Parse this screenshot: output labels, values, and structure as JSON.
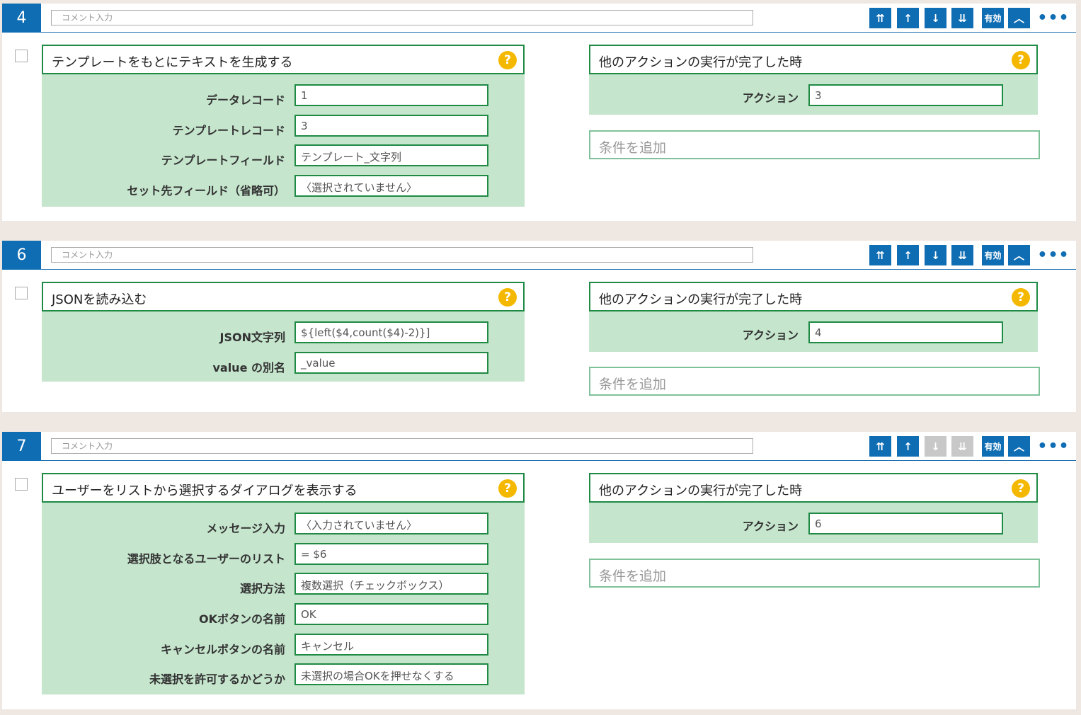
{
  "comment_placeholder": "コメント入力",
  "toolbar": {
    "top_icon": "⇈",
    "up_icon": "↑",
    "down_icon": "↓",
    "bottom_icon": "⇊",
    "enable_label": "有効",
    "collapse_icon": "︿",
    "more_icon": "•••"
  },
  "help_icon": "?",
  "condition": {
    "title": "他のアクションの実行が完了した時",
    "action_label": "アクション",
    "add_placeholder": "条件を追加"
  },
  "blocks": [
    {
      "number": "4",
      "title": "テンプレートをもとにテキストを生成する",
      "fields": [
        {
          "label": "データレコード",
          "value": "1"
        },
        {
          "label": "テンプレートレコード",
          "value": "3"
        },
        {
          "label": "テンプレートフィールド",
          "value": "テンプレート_文字列"
        },
        {
          "label": "セット先フィールド（省略可）",
          "value": "〈選択されていません〉"
        }
      ],
      "condition_action": "3"
    },
    {
      "number": "6",
      "title": "JSONを読み込む",
      "fields": [
        {
          "label": "JSON文字列",
          "value": "${left($4,count($4)-2)}]"
        },
        {
          "label": "value の別名",
          "value": "_value"
        }
      ],
      "condition_action": "4"
    },
    {
      "number": "7",
      "title": "ユーザーをリストから選択するダイアログを表示する",
      "fields": [
        {
          "label": "メッセージ入力",
          "value": "〈入力されていません〉"
        },
        {
          "label": "選択肢となるユーザーのリスト",
          "value": "= $6"
        },
        {
          "label": "選択方法",
          "value": "複数選択（チェックボックス）"
        },
        {
          "label": "OKボタンの名前",
          "value": "OK"
        },
        {
          "label": "キャンセルボタンの名前",
          "value": "キャンセル"
        },
        {
          "label": "未選択を許可するかどうか",
          "value": "未選択の場合OKを押せなくする"
        }
      ],
      "condition_action": "6"
    }
  ]
}
